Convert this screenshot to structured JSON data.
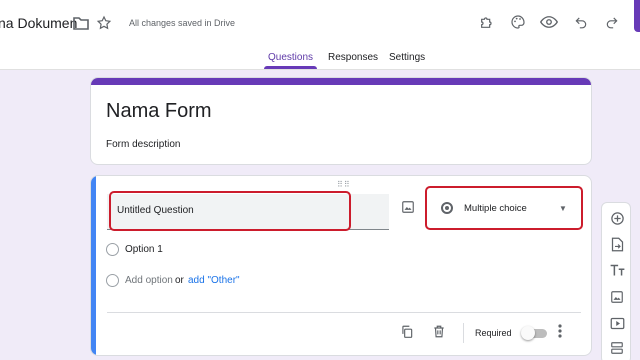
{
  "header": {
    "doc_title": "na Dokumen",
    "saved_status": "All changes saved in Drive",
    "icons": [
      "folder-icon",
      "star-icon",
      "addon-puzzle-icon",
      "palette-icon",
      "preview-eye-icon",
      "undo-icon",
      "redo-icon"
    ]
  },
  "tabs": [
    "Questions",
    "Responses",
    "Settings"
  ],
  "active_tab": "Questions",
  "form": {
    "title": "Nama Form",
    "description": "Form description"
  },
  "question": {
    "title": "Untitled Question",
    "type": "Multiple choice",
    "options": [
      "Option 1"
    ],
    "add_option": "Add option",
    "or": "or",
    "add_other": "add \"Other\"",
    "required_label": "Required",
    "required": false
  },
  "side_toolbar": [
    "add-question-icon",
    "import-questions-icon",
    "add-title-icon",
    "add-image-icon",
    "add-video-icon",
    "add-section-icon"
  ],
  "colors": {
    "accent": "#673ab7",
    "background": "#f0ebf8",
    "focus_strip": "#4285f4",
    "link": "#1a73e8",
    "annotation_red": "#cc1c2c"
  }
}
